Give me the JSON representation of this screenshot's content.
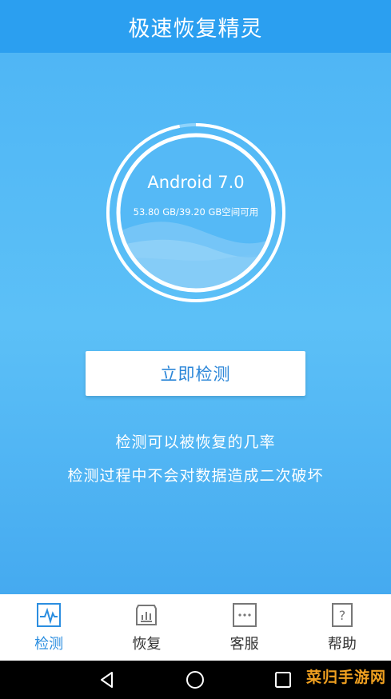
{
  "app": {
    "title": "极速恢复精灵"
  },
  "device": {
    "os_name": "Android 7.0",
    "storage_text": "53.80 GB/39.20 GB空间可用",
    "storage_used_fraction": 0.97
  },
  "actions": {
    "detect_label": "立即检测"
  },
  "description": {
    "line1": "检测可以被恢复的几率",
    "line2": "检测过程中不会对数据造成二次破坏"
  },
  "tabs": [
    {
      "label": "检测",
      "icon": "waveform-icon",
      "active": true
    },
    {
      "label": "恢复",
      "icon": "recover-chart-icon",
      "active": false
    },
    {
      "label": "客服",
      "icon": "chat-bubble-icon",
      "active": false
    },
    {
      "label": "帮助",
      "icon": "question-doc-icon",
      "active": false
    }
  ],
  "system_nav": [
    "back-icon",
    "home-icon",
    "recents-icon"
  ],
  "watermark": {
    "text": "菜归手游网"
  },
  "colors": {
    "primary": "#2b9ff0",
    "accent_text": "#2b86d8",
    "tab_active": "#2b8ee0"
  }
}
